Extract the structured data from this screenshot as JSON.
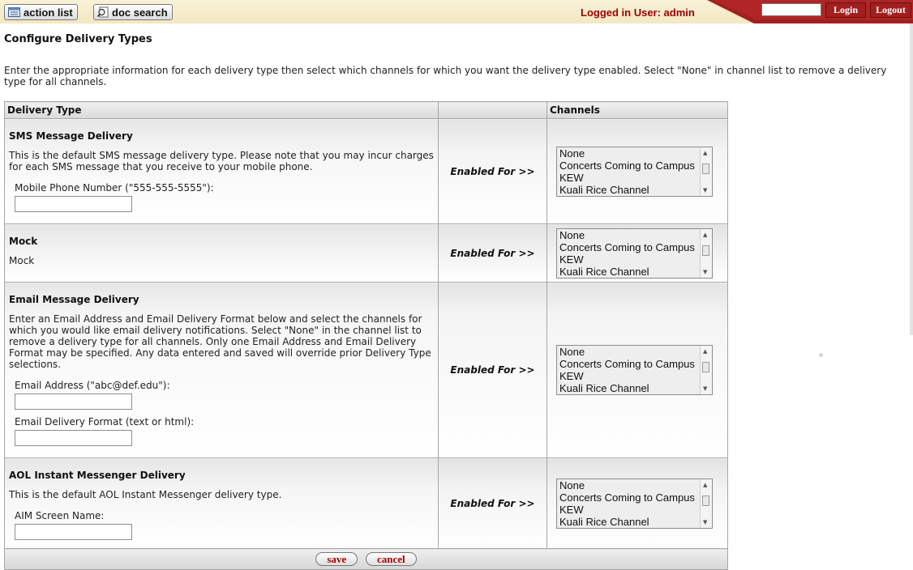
{
  "topbar": {
    "action_list": "action list",
    "doc_search": "doc search",
    "logged_in": "Logged in User: admin",
    "login": "Login",
    "logout": "Logout"
  },
  "page": {
    "title": "Configure Delivery Types",
    "intro": "Enter the appropriate information for each delivery type then select which channels for which you want the delivery type enabled. Select \"None\" in channel list to remove a delivery type for all channels."
  },
  "table": {
    "headers": [
      "Delivery Type",
      "",
      "Channels"
    ],
    "enabled_label": "Enabled For >>",
    "rows": [
      {
        "name": "SMS Message Delivery",
        "description": "This is the default SMS message delivery type. Please note that you may incur charges for each SMS message that you receive to your mobile phone.",
        "fields": [
          {
            "label": "Mobile Phone Number (\"555-555-5555\"):",
            "value": ""
          }
        ],
        "channels": [
          "None",
          "Concerts Coming to Campus",
          "KEW",
          "Kuali Rice Channel"
        ]
      },
      {
        "name": "Mock",
        "description": "Mock",
        "fields": [],
        "channels": [
          "None",
          "Concerts Coming to Campus",
          "KEW",
          "Kuali Rice Channel"
        ]
      },
      {
        "name": "Email Message Delivery",
        "description": "Enter an Email Address and Email Delivery Format below and select the channels for which you would like email delivery notifications. Select \"None\" in the channel list to remove a delivery type for all channels. Only one Email Address and Email Delivery Format may be specified. Any data entered and saved will override prior Delivery Type selections.",
        "fields": [
          {
            "label": "Email Address (\"abc@def.edu\"):",
            "value": ""
          },
          {
            "label": "Email Delivery Format (text or html):",
            "value": ""
          }
        ],
        "channels": [
          "None",
          "Concerts Coming to Campus",
          "KEW",
          "Kuali Rice Channel"
        ]
      },
      {
        "name": "AOL Instant Messenger Delivery",
        "description": "This is the default AOL Instant Messenger delivery type.",
        "fields": [
          {
            "label": "AIM Screen Name:",
            "value": ""
          }
        ],
        "channels": [
          "None",
          "Concerts Coming to Campus",
          "KEW",
          "Kuali Rice Channel"
        ]
      }
    ]
  },
  "buttons": {
    "save": "save",
    "cancel": "cancel"
  },
  "colors": {
    "accent_red": "#a31f1f",
    "topbar_bg": "#f6eecd",
    "text_red": "#a00000"
  }
}
